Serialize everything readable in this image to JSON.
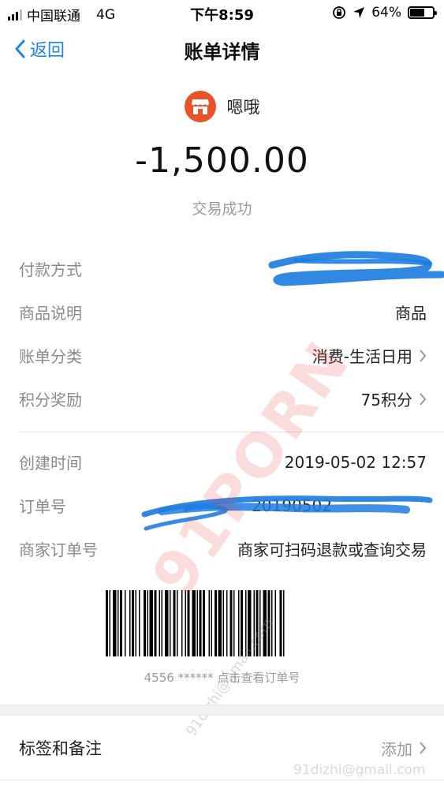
{
  "status_bar": {
    "carrier": "中国联通",
    "network": "4G",
    "time": "下午8:59",
    "battery_percent": "64%",
    "battery_level": 0.64
  },
  "nav": {
    "back_label": "返回",
    "title": "账单详情"
  },
  "merchant": {
    "name": "嗯哦",
    "icon": "store-icon",
    "icon_color": "#e8532a"
  },
  "amount": "-1,500.00",
  "status": "交易成功",
  "details": [
    {
      "label": "付款方式",
      "value": "",
      "chevron": true
    },
    {
      "label": "商品说明",
      "value": "商品",
      "chevron": false
    },
    {
      "label": "账单分类",
      "value": "消费-生活日用",
      "chevron": true
    },
    {
      "label": "积分奖励",
      "value": "75积分",
      "chevron": true
    }
  ],
  "details2": [
    {
      "label": "创建时间",
      "value": "2019-05-02 12:57",
      "chevron": false
    },
    {
      "label": "订单号",
      "value": "20190502",
      "chevron": false
    },
    {
      "label": "商家订单号",
      "value": "商家可扫码退款或查询交易",
      "chevron": false
    }
  ],
  "barcode": {
    "caption": "4556 ****** 点击查看订单号"
  },
  "tags": {
    "label": "标签和备注",
    "action": "添加"
  },
  "watermark": {
    "main": "91PORN",
    "secondary": "91dizhi@gmail.com",
    "bottom": "91dizhi@gmail.com"
  },
  "colors": {
    "accent": "#1b86e6",
    "scribble": "#1e7ee0"
  }
}
